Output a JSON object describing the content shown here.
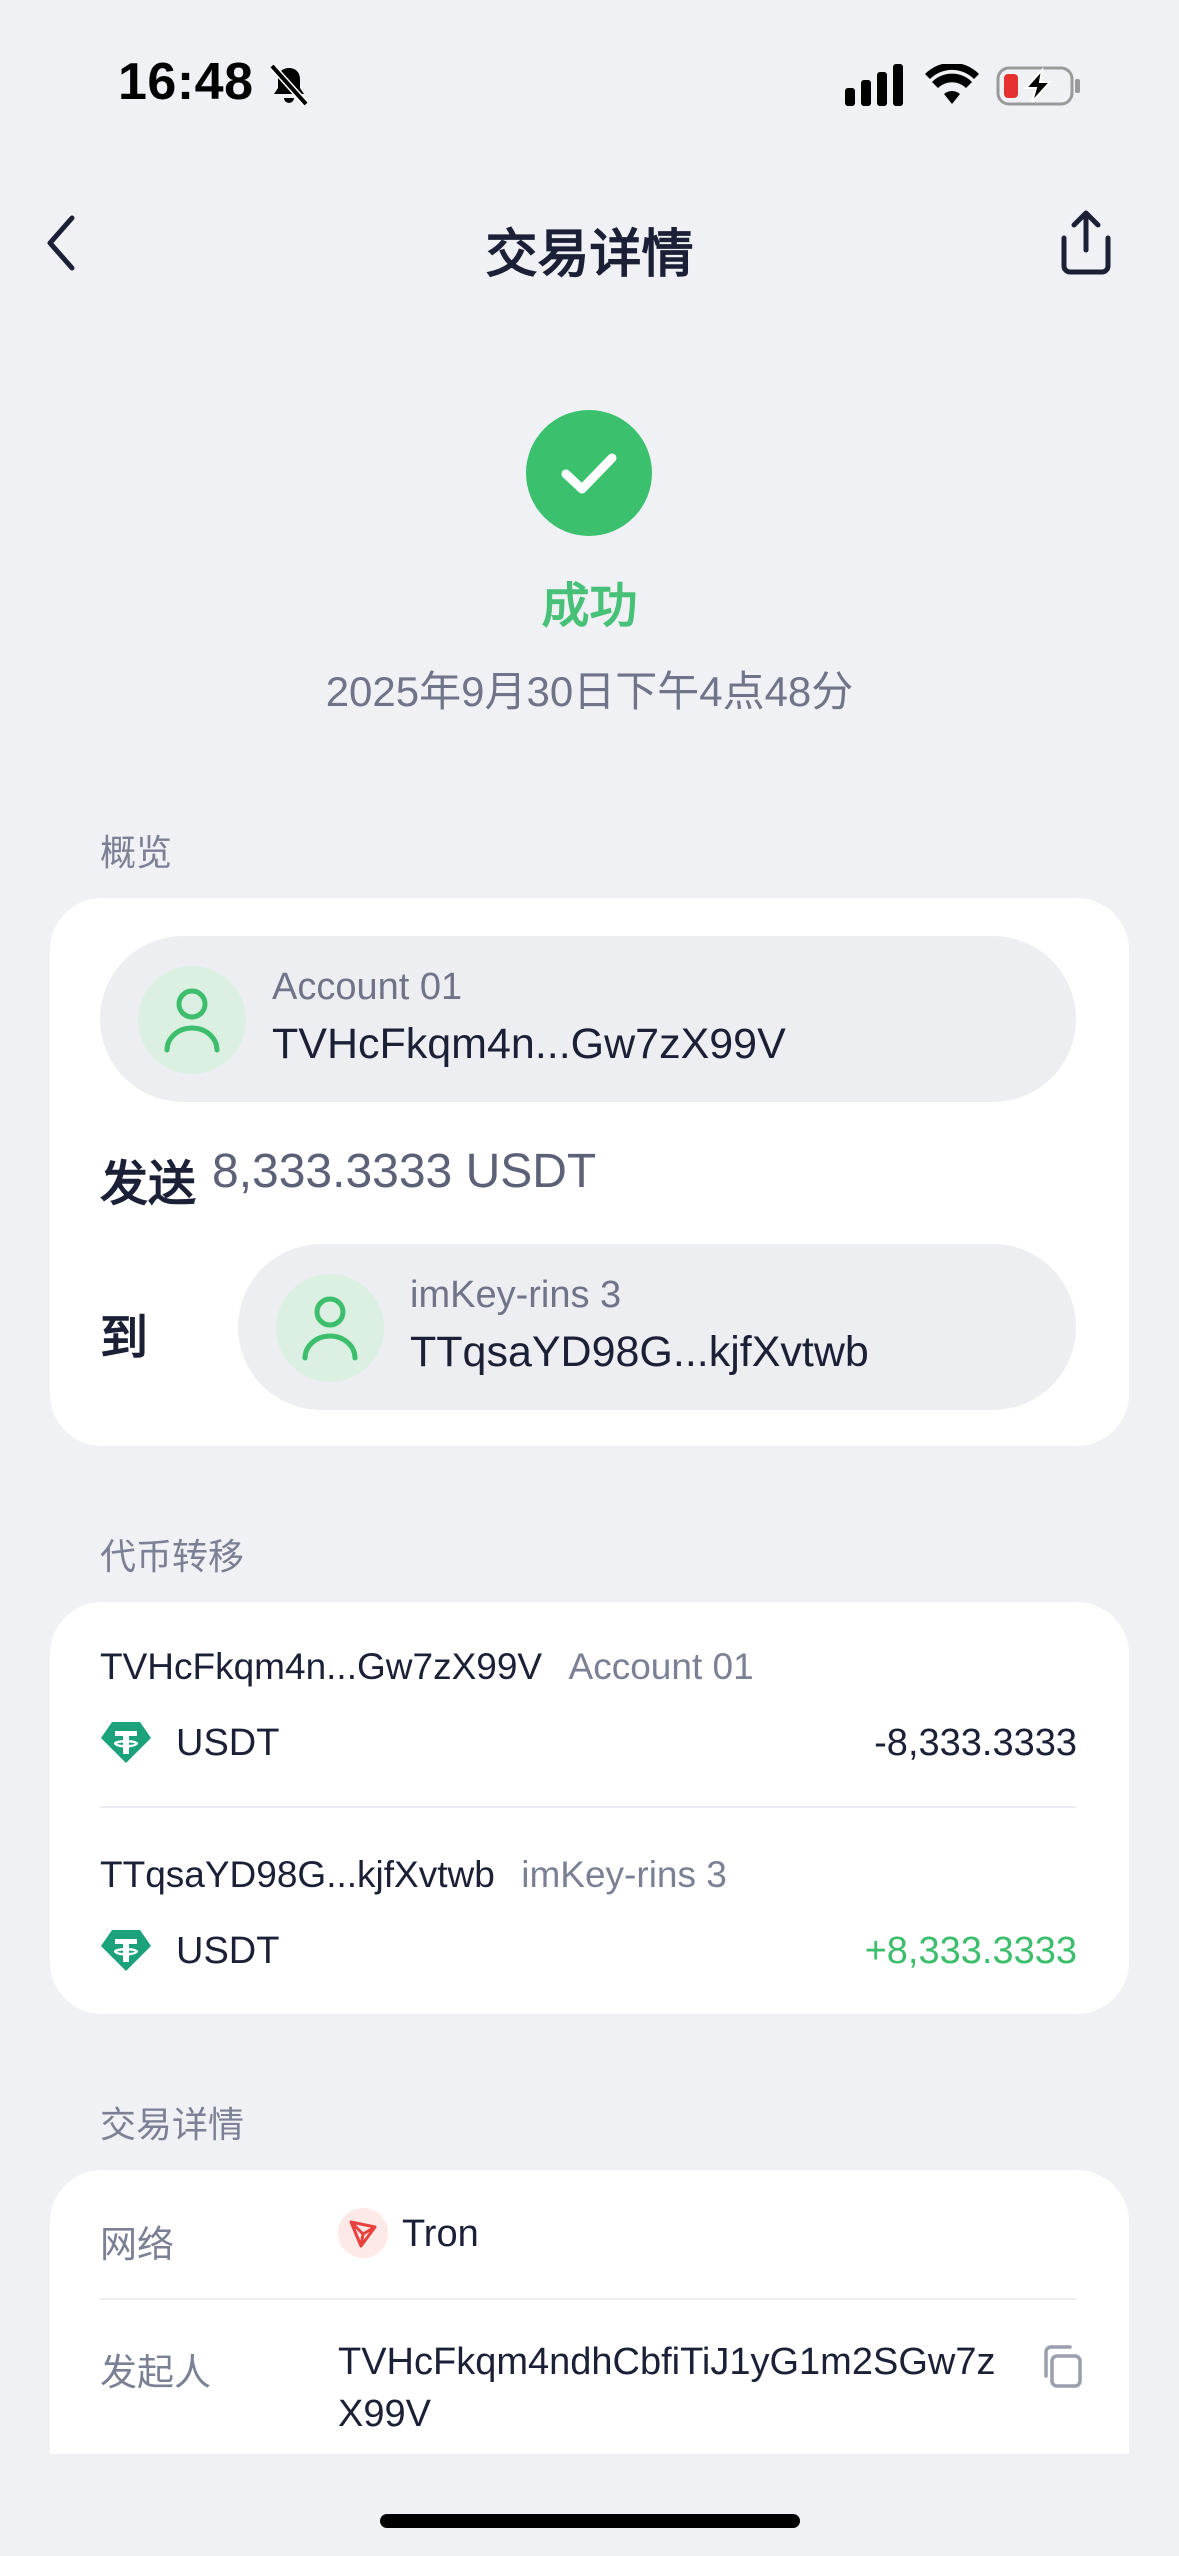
{
  "status_bar": {
    "time": "16:48"
  },
  "nav": {
    "title": "交易详情"
  },
  "hero": {
    "status": "成功",
    "date": "2025年9月30日下午4点48分"
  },
  "overview": {
    "section_title": "概览",
    "from": {
      "name": "Account 01",
      "address": "TVHcFkqm4n...Gw7zX99V"
    },
    "send_label": "发送",
    "send_amount": "8,333.3333 USDT",
    "to_label": "到",
    "to": {
      "name": "imKey-rins 3",
      "address": "TTqsaYD98G...kjfXvtwb"
    }
  },
  "transfers": {
    "section_title": "代币转移",
    "items": [
      {
        "address": "TVHcFkqm4n...Gw7zX99V",
        "name": "Account 01",
        "token": "USDT",
        "amount": "-8,333.3333",
        "color": "#1B2036"
      },
      {
        "address": "TTqsaYD98G...kjfXvtwb",
        "name": "imKey-rins 3",
        "token": "USDT",
        "amount": "+8,333.3333",
        "color": "#3DBE6C"
      }
    ]
  },
  "details": {
    "section_title": "交易详情",
    "network_label": "网络",
    "network_value": "Tron",
    "initiator_label": "发起人",
    "initiator_line1": "TVHcFkqm4ndhCbfiTiJ1yG1m2SGw7z",
    "initiator_line2": "X99V"
  },
  "colors": {
    "success": "#3BC06E",
    "tether": "#1BA27A",
    "tron": "#E8413E",
    "background": "#F0F1F4"
  }
}
